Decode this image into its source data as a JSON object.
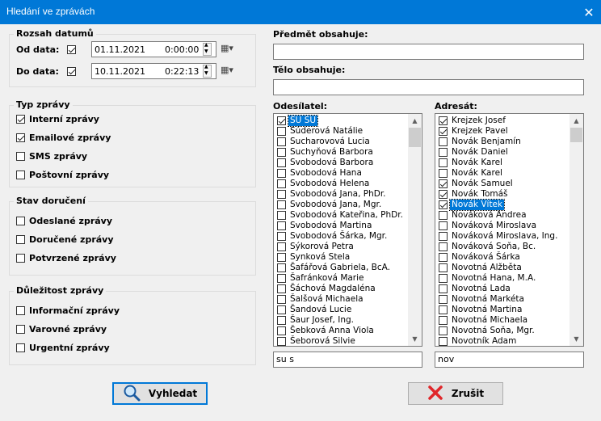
{
  "window": {
    "title": "Hledání ve zprávách",
    "close_glyph": "✕"
  },
  "date_range": {
    "group_label": "Rozsah datumů",
    "from_label": "Od data:",
    "from_checked": true,
    "from_date": "01.11.2021",
    "from_time": "0:00:00",
    "to_label": "Do data:",
    "to_checked": true,
    "to_date": "10.11.2021",
    "to_time": "0:22:13"
  },
  "message_type": {
    "group_label": "Typ zprávy",
    "items": [
      {
        "label": "Interní zprávy",
        "checked": true
      },
      {
        "label": "Emailové zprávy",
        "checked": true
      },
      {
        "label": "SMS zprávy",
        "checked": false
      },
      {
        "label": "Poštovní zprávy",
        "checked": false
      }
    ]
  },
  "delivery_state": {
    "group_label": "Stav doručení",
    "items": [
      {
        "label": "Odeslané zprávy",
        "checked": false
      },
      {
        "label": "Doručené zprávy",
        "checked": false
      },
      {
        "label": "Potvrzené zprávy",
        "checked": false
      }
    ]
  },
  "importance": {
    "group_label": "Důležitost zprávy",
    "items": [
      {
        "label": "Informační zprávy",
        "checked": false
      },
      {
        "label": "Varovné zprávy",
        "checked": false
      },
      {
        "label": "Urgentní zprávy",
        "checked": false
      }
    ]
  },
  "subject": {
    "label": "Předmět obsahuje:",
    "value": ""
  },
  "body": {
    "label": "Tělo obsahuje:",
    "value": ""
  },
  "sender": {
    "label": "Odesílatel:",
    "filter": "su s",
    "items": [
      {
        "name": "SU SU",
        "checked": true,
        "selected": true
      },
      {
        "name": "Súderová Natálie",
        "checked": false
      },
      {
        "name": "Sucharovová Lucia",
        "checked": false
      },
      {
        "name": "Suchyňová Barbora",
        "checked": false
      },
      {
        "name": "Svobodová Barbora",
        "checked": false
      },
      {
        "name": "Svobodová Hana",
        "checked": false
      },
      {
        "name": "Svobodová Helena",
        "checked": false
      },
      {
        "name": "Svobodová Jana, PhDr.",
        "checked": false
      },
      {
        "name": "Svobodová Jana, Mgr.",
        "checked": false
      },
      {
        "name": "Svobodová Kateřina, PhDr.",
        "checked": false
      },
      {
        "name": "Svobodová Martina",
        "checked": false
      },
      {
        "name": "Svobodová Šárka, Mgr.",
        "checked": false
      },
      {
        "name": "Sýkorová Petra",
        "checked": false
      },
      {
        "name": "Synková Stela",
        "checked": false
      },
      {
        "name": "Šafářová Gabriela, BcA.",
        "checked": false
      },
      {
        "name": "Šafránková Marie",
        "checked": false
      },
      {
        "name": "Šáchová Magdaléna",
        "checked": false
      },
      {
        "name": "Šalšová Michaela",
        "checked": false
      },
      {
        "name": "Šandová Lucie",
        "checked": false
      },
      {
        "name": "Šaur Josef, Ing.",
        "checked": false
      },
      {
        "name": "Šebková Anna Viola",
        "checked": false
      },
      {
        "name": "Šeborová Silvie",
        "checked": false
      }
    ]
  },
  "recipient": {
    "label": "Adresát:",
    "filter": "nov",
    "items": [
      {
        "name": "Krejzek Josef",
        "checked": true
      },
      {
        "name": "Krejzek Pavel",
        "checked": true
      },
      {
        "name": "Novák Benjamín",
        "checked": false
      },
      {
        "name": "Novák Daniel",
        "checked": false
      },
      {
        "name": "Novák Karel",
        "checked": false
      },
      {
        "name": "Novák Karel",
        "checked": false
      },
      {
        "name": "Novák Samuel",
        "checked": true
      },
      {
        "name": "Novák Tomáš",
        "checked": true
      },
      {
        "name": "Novák Vítek",
        "checked": true,
        "selected": true
      },
      {
        "name": "Nováková Andrea",
        "checked": false
      },
      {
        "name": "Nováková Miroslava",
        "checked": false
      },
      {
        "name": "Nováková Miroslava, Ing.",
        "checked": false
      },
      {
        "name": "Nováková Soňa, Bc.",
        "checked": false
      },
      {
        "name": "Nováková Šárka",
        "checked": false
      },
      {
        "name": "Novotná Alžběta",
        "checked": false
      },
      {
        "name": "Novotná Hana, M.A.",
        "checked": false
      },
      {
        "name": "Novotná Lada",
        "checked": false
      },
      {
        "name": "Novotná Markéta",
        "checked": false
      },
      {
        "name": "Novotná Martina",
        "checked": false
      },
      {
        "name": "Novotná Michaela",
        "checked": false
      },
      {
        "name": "Novotná Soňa, Mgr.",
        "checked": false
      },
      {
        "name": "Novotník Adam",
        "checked": false
      }
    ]
  },
  "buttons": {
    "search_label": "Vyhledat",
    "cancel_label": "Zrušit"
  },
  "colors": {
    "accent": "#0078d7",
    "cancel_red": "#e0262a"
  }
}
